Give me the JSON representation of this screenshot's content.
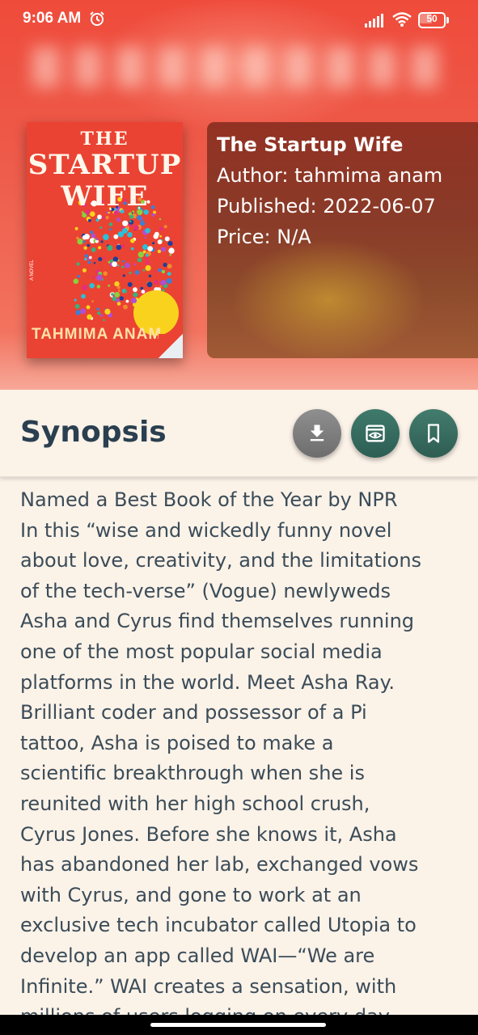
{
  "status_bar": {
    "time": "9:06 AM",
    "battery": "50",
    "battery_level": 0.5
  },
  "book": {
    "cover": {
      "title_line1": "THE",
      "title_line2": "STARTUP",
      "title_line3": "WIFE",
      "author": "TAHMIMA ANAM",
      "label": "A NOVEL"
    },
    "title": "The Startup Wife",
    "author_line": "Author: tahmima anam",
    "published_line": "Published: 2022-06-07",
    "price_line": "Price: N/A"
  },
  "synopsis": {
    "heading": "Synopsis",
    "lines": [
      "Named a Best Book of the Year by NPR",
      "In this “wise and wickedly funny novel",
      "about love, creativity, and the limitations",
      "of the tech-verse” (Vogue) newlyweds",
      "Asha and Cyrus find themselves running",
      "one of the most popular social media",
      "platforms in the world. Meet Asha Ray.",
      "Brilliant coder and possessor of a Pi",
      "tattoo, Asha is poised to make a",
      "scientific breakthrough when she is",
      "reunited with her high school crush,",
      "Cyrus Jones. Before she knows it, Asha",
      "has abandoned her lab, exchanged vows",
      "with Cyrus, and gone to work at an",
      "exclusive tech incubator called Utopia to",
      "develop an app called WAI—“We are",
      "Infinite.” WAI creates a sensation, with",
      "millions of users logging on every day"
    ]
  },
  "actions": {
    "download_icon": "download-icon",
    "preview_icon": "preview-icon",
    "bookmark_icon": "bookmark-icon"
  },
  "colors": {
    "hero_red": "#ef4b3b",
    "panel_brown": "#8a3a28",
    "page_bg": "#fbf2e8",
    "heading_text": "#2a3f4f",
    "fab_green": "#3f7a6b",
    "fab_grey": "#7d7d7d"
  }
}
